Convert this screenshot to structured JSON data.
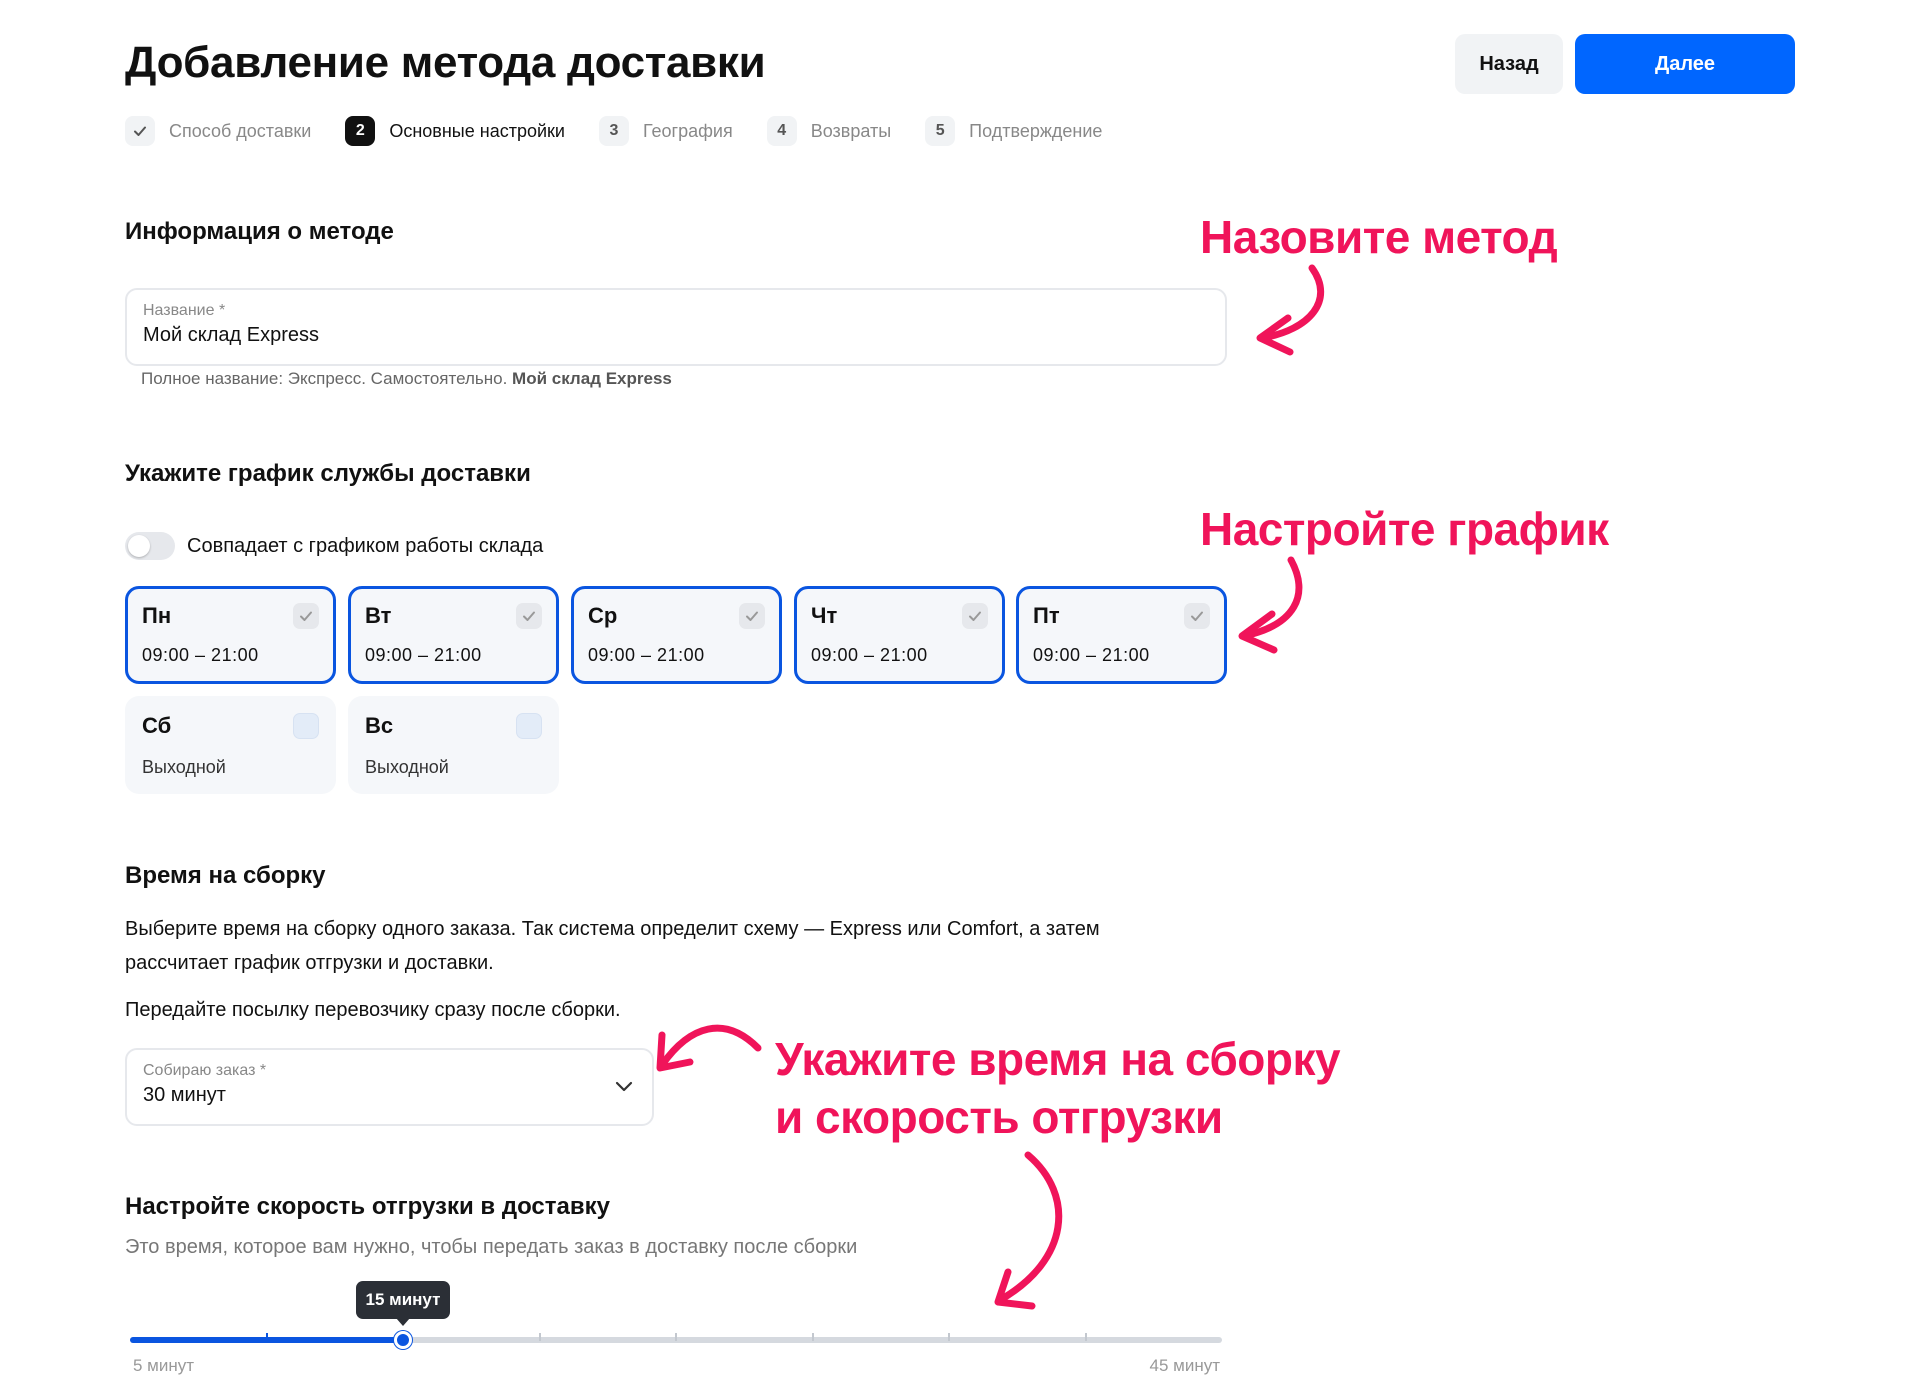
{
  "header": {
    "title": "Добавление метода доставки",
    "back_label": "Назад",
    "next_label": "Далее"
  },
  "stepper": {
    "steps": [
      {
        "badge": "",
        "label": "Способ доставки",
        "state": "done"
      },
      {
        "badge": "2",
        "label": "Основные настройки",
        "state": "active"
      },
      {
        "badge": "3",
        "label": "География",
        "state": "pending"
      },
      {
        "badge": "4",
        "label": "Возвраты",
        "state": "pending"
      },
      {
        "badge": "5",
        "label": "Подтверждение",
        "state": "pending"
      }
    ]
  },
  "method_info": {
    "title": "Информация о методе",
    "name_label": "Название *",
    "name_value": "Мой склад Express",
    "hint_prefix": "Полное название: Экспресс. Самостоятельно. ",
    "hint_bold": "Мой склад Express"
  },
  "schedule": {
    "title": "Укажите график службы доставки",
    "toggle_label": "Совпадает с графиком работы склада",
    "toggle_on": false,
    "days": [
      {
        "name": "Пн",
        "time": "09:00 – 21:00",
        "enabled": true
      },
      {
        "name": "Вт",
        "time": "09:00 – 21:00",
        "enabled": true
      },
      {
        "name": "Ср",
        "time": "09:00 – 21:00",
        "enabled": true
      },
      {
        "name": "Чт",
        "time": "09:00 – 21:00",
        "enabled": true
      },
      {
        "name": "Пт",
        "time": "09:00 – 21:00",
        "enabled": true
      },
      {
        "name": "Сб",
        "time": "Выходной",
        "enabled": false
      },
      {
        "name": "Вс",
        "time": "Выходной",
        "enabled": false
      }
    ]
  },
  "assembly": {
    "title": "Время на сборку",
    "text1_line1": "Выберите время на сборку одного заказа. Так система определит схему — Express или Comfort, а затем",
    "text1_line2": "рассчитает график отгрузки и доставки.",
    "text2": "Передайте посылку перевозчику сразу после сборки.",
    "select_label": "Собираю заказ *",
    "select_value": "30 минут"
  },
  "shipping_speed": {
    "title": "Настройте скорость отгрузки в доставку",
    "subtitle": "Это время, которое вам нужно, чтобы передать заказ в доставку после сборки",
    "slider": {
      "min_label": "5 минут",
      "max_label": "45 минут",
      "current_label": "15 минут",
      "steps": 8,
      "value_index": 2
    }
  },
  "annotations": {
    "name_method": "Назовите метод",
    "set_schedule": "Настройте график",
    "time_line1": "Укажите время на сборку",
    "time_line2": "и скорость отгрузки",
    "color": "#f0145a"
  },
  "colors": {
    "accent": "#0066ff",
    "selected_border": "#0a55e0",
    "annotation": "#f0145a"
  }
}
